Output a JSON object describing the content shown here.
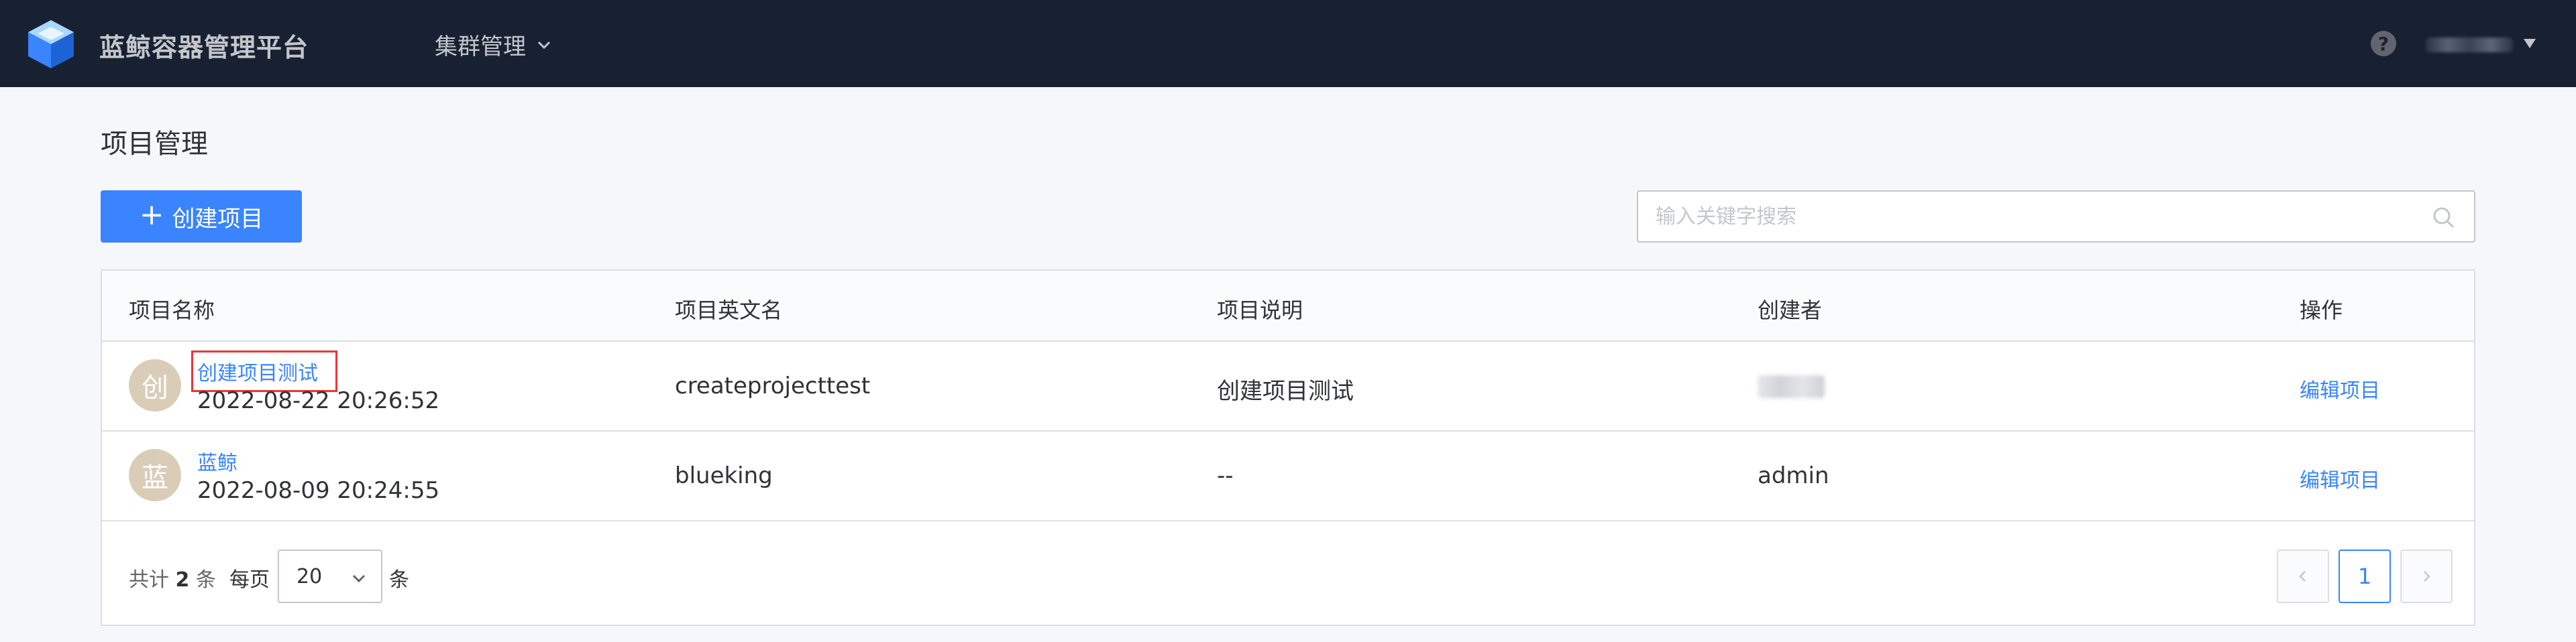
{
  "header": {
    "app_title": "蓝鲸容器管理平台",
    "nav_menu_label": "集群管理",
    "help_label": "?"
  },
  "page": {
    "title": "项目管理",
    "create_button_label": "创建项目",
    "search_placeholder": "输入关键字搜索"
  },
  "table": {
    "columns": [
      "项目名称",
      "项目英文名",
      "项目说明",
      "创建者",
      "操作"
    ],
    "rows": [
      {
        "avatar_char": "创",
        "name": "创建项目测试",
        "created_at": "2022-08-22 20:26:52",
        "english_name": "createprojecttest",
        "description": "创建项目测试",
        "creator": "",
        "action": "编辑项目"
      },
      {
        "avatar_char": "蓝",
        "name": "蓝鲸",
        "created_at": "2022-08-09 20:24:55",
        "english_name": "blueking",
        "description": "--",
        "creator": "admin",
        "action": "编辑项目"
      }
    ]
  },
  "pagination": {
    "total_prefix": "共计",
    "total_count": "2",
    "total_suffix": "条",
    "per_page_label": "每页",
    "per_page_value": "20",
    "per_page_unit": "条",
    "current_page": "1"
  },
  "colors": {
    "topbar_bg": "#182132",
    "primary": "#3a84ff",
    "highlight_box": "#ea3636"
  }
}
